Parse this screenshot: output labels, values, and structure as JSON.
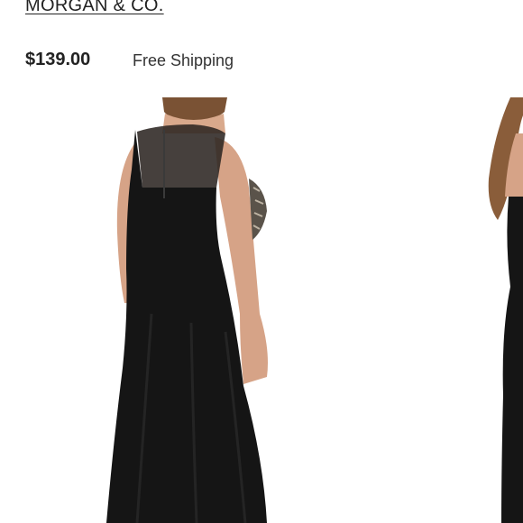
{
  "product": {
    "brand": "MORGAN & CO.",
    "price": "$139.00",
    "shipping": "Free Shipping"
  },
  "gallery": {
    "main_image_icon": "dress-back-view-image",
    "next_image_icon": "dress-side-view-image-peek"
  },
  "colors": {
    "text": "#222222",
    "dress": "#151515",
    "skin": "#d9a98c",
    "hair": "#7a5234",
    "background": "#ffffff"
  }
}
